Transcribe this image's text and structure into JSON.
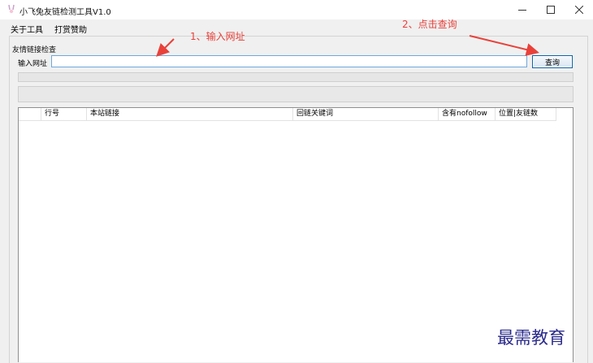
{
  "window": {
    "title": "小飞兔友链检测工具V1.0"
  },
  "menu": {
    "items": [
      "关于工具",
      "打赏赞助"
    ]
  },
  "form": {
    "group_label": "友情链接检查",
    "url_label": "输入网址",
    "url_value": "",
    "query_button": "查询"
  },
  "table": {
    "columns": [
      "",
      "行号",
      "本站链接",
      "回链关键词",
      "含有nofollow",
      "位置|友链数"
    ]
  },
  "annotations": {
    "step1": "1、输入网址",
    "step2": "2、点击查询"
  },
  "watermark": "最需教育",
  "colors": {
    "annotation": "#e9413a",
    "watermark": "#2b2b8c",
    "input_border": "#6fa8dc"
  }
}
